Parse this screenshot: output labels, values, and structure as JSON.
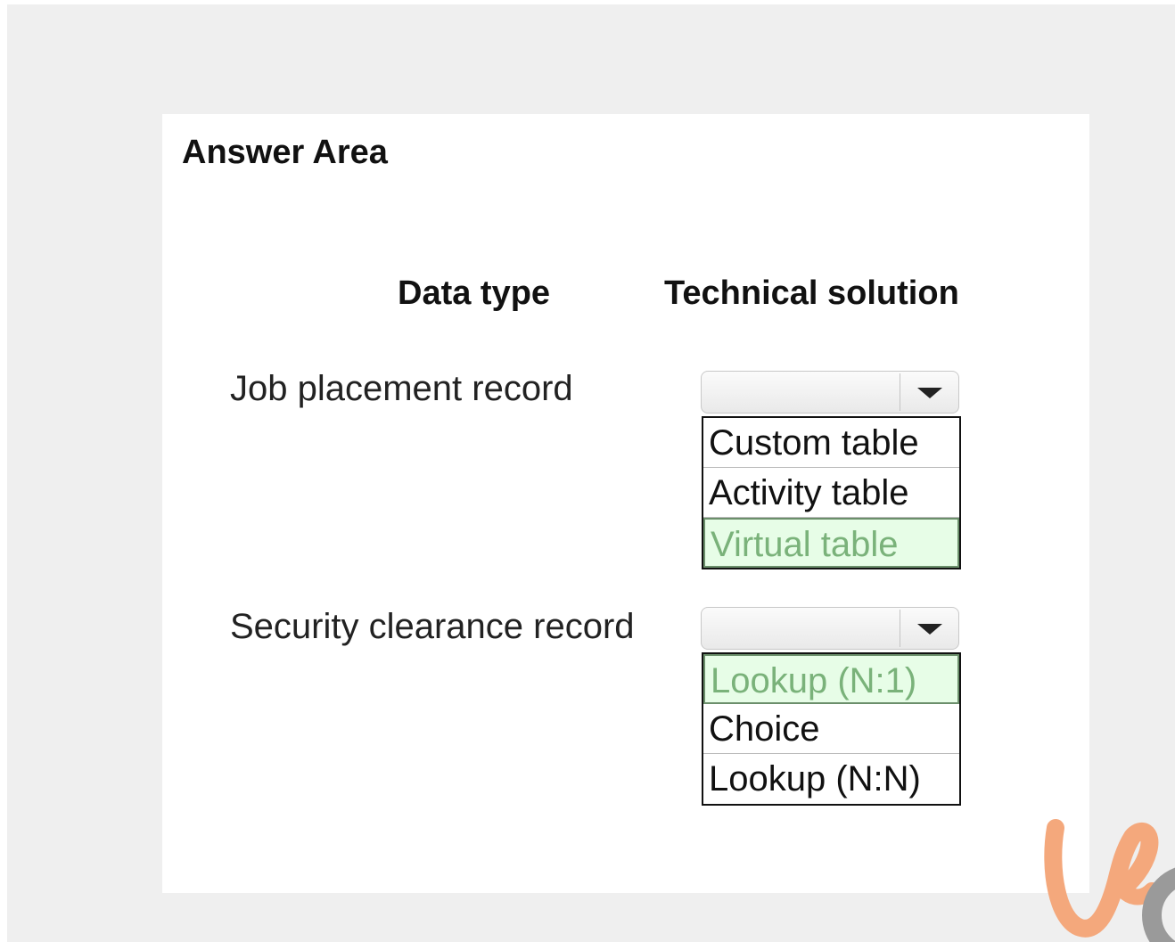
{
  "answer_area": {
    "title": "Answer Area",
    "columns": {
      "data_type": "Data type",
      "technical_solution": "Technical solution"
    },
    "rows": [
      {
        "label": "Job placement record",
        "dropdown_value": "",
        "options": [
          "Custom table",
          "Activity table",
          "Virtual table"
        ],
        "selected": "Virtual table"
      },
      {
        "label": "Security clearance record",
        "dropdown_value": "",
        "options": [
          "Lookup (N:1)",
          "Choice",
          "Lookup (N:N)"
        ],
        "selected": "Lookup (N:1)"
      }
    ]
  },
  "colors": {
    "selected_bg": "#e7fde7",
    "selected_text": "#7ab27a",
    "watermark": "#f4a87c"
  },
  "icons": {
    "dropdown_arrow": "chevron-down-icon",
    "watermark": "logo-mark"
  }
}
